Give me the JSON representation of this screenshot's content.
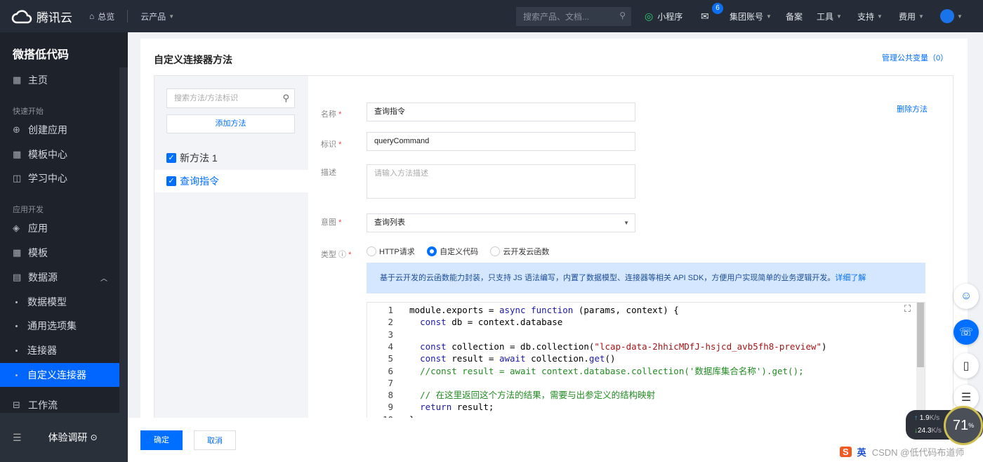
{
  "topbar": {
    "brand": "腾讯云",
    "overview": "总览",
    "products": "云产品",
    "search_placeholder": "搜索产品、文档...",
    "miniprogram": "小程序",
    "mail_count": "6",
    "account": "集团账号",
    "record": "备案",
    "tools": "工具",
    "support": "支持",
    "billing": "费用"
  },
  "sidebar": {
    "title": "微搭低代码",
    "home": "主页",
    "group_quick": "快速开始",
    "create_app": "创建应用",
    "templates_center": "模板中心",
    "learning": "学习中心",
    "group_dev": "应用开发",
    "apps": "应用",
    "templates": "模板",
    "datasource": "数据源",
    "data_model": "数据模型",
    "options": "通用选项集",
    "connector": "连接器",
    "custom_connector": "自定义连接器",
    "workflow": "工作流",
    "survey": "体验调研"
  },
  "page": {
    "title": "自定义连接器方法",
    "manage_vars": "管理公共变量（0）",
    "search_placeholder": "搜索方法/方法标识",
    "add_method": "添加方法",
    "methods": [
      {
        "label": "新方法 1"
      },
      {
        "label": "查询指令"
      }
    ],
    "delete_method": "删除方法",
    "form": {
      "name_label": "名称",
      "name_value": "查询指令",
      "id_label": "标识",
      "id_value": "queryCommand",
      "desc_label": "描述",
      "desc_placeholder": "请输入方法描述",
      "intent_label": "意图",
      "intent_value": "查询列表",
      "type_label": "类型",
      "types": [
        {
          "label": "HTTP请求",
          "selected": false
        },
        {
          "label": "自定义代码",
          "selected": true
        },
        {
          "label": "云开发云函数",
          "selected": false
        }
      ],
      "info_text": "基于云开发的云函数能力封装，只支持 JS 语法编写，内置了数据模型、连接器等相关 API SDK，方便用户实现简单的业务逻辑开发。",
      "info_link": "详细了解"
    },
    "code_lines": [
      [
        {
          "t": "module.exports = ",
          "c": "pl"
        },
        {
          "t": "async function",
          "c": "kw"
        },
        {
          "t": " (params, context) {",
          "c": "pl"
        }
      ],
      [
        {
          "t": "  "
        },
        {
          "t": "const",
          "c": "kw"
        },
        {
          "t": " db = context.database",
          "c": "pl"
        }
      ],
      [
        {
          "t": ""
        }
      ],
      [
        {
          "t": "  "
        },
        {
          "t": "const",
          "c": "kw"
        },
        {
          "t": " collection = db.collection(",
          "c": "pl"
        },
        {
          "t": "\"lcap-data-2hhicMDfJ-hsjcd_avb5fh8-preview\"",
          "c": "str"
        },
        {
          "t": ")",
          "c": "pl"
        }
      ],
      [
        {
          "t": "  "
        },
        {
          "t": "const",
          "c": "kw"
        },
        {
          "t": " result = ",
          "c": "pl"
        },
        {
          "t": "await",
          "c": "kw"
        },
        {
          "t": " collection.",
          "c": "pl"
        },
        {
          "t": "get",
          "c": "kw"
        },
        {
          "t": "()",
          "c": "pl"
        }
      ],
      [
        {
          "t": "  "
        },
        {
          "t": "//const result = await context.database.collection('数据库集合名称').get();",
          "c": "cm"
        }
      ],
      [
        {
          "t": ""
        }
      ],
      [
        {
          "t": "  "
        },
        {
          "t": "// 在这里返回这个方法的结果，需要与出参定义的结构映射",
          "c": "cm"
        }
      ],
      [
        {
          "t": "  "
        },
        {
          "t": "return",
          "c": "kw"
        },
        {
          "t": " result;",
          "c": "pl"
        }
      ],
      [
        {
          "t": "}",
          "c": "pl"
        }
      ]
    ],
    "confirm": "确定",
    "cancel": "取消"
  },
  "overlay": {
    "upload": "1.9",
    "download": "24.3",
    "unit": "K/s",
    "cpu": "71",
    "cpu_unit": "%",
    "ime_lang": "英",
    "watermark": "CSDN @低代码布道师"
  },
  "colors": {
    "accent": "#006eff",
    "topbar": "#262c37",
    "sidebar": "#1e222b"
  }
}
